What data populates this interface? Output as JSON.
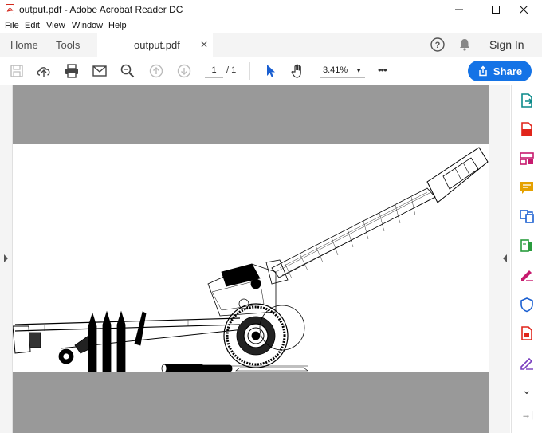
{
  "window": {
    "title": "output.pdf - Adobe Acrobat Reader DC",
    "controls": [
      "minimize",
      "maximize",
      "close"
    ]
  },
  "menu": [
    "File",
    "Edit",
    "View",
    "Window",
    "Help"
  ],
  "tabs": {
    "home": "Home",
    "tools": "Tools",
    "document": "output.pdf",
    "close_symbol": "✕"
  },
  "account": {
    "sign_in": "Sign In"
  },
  "toolbar": {
    "page_current": "1",
    "page_total": "/ 1",
    "zoom": "3.41%",
    "more": "•••",
    "share_label": "Share",
    "icons": [
      "save-icon",
      "upload-icon",
      "print-icon",
      "email-icon",
      "zoom-search-icon",
      "page-up-icon",
      "page-down-icon",
      "select-cursor-icon",
      "hand-tool-icon",
      "more-icon"
    ]
  },
  "right_panel": {
    "tools": [
      "export-pdf-icon",
      "create-pdf-icon",
      "organize-pages-icon",
      "comment-icon",
      "combine-files-icon",
      "edit-pdf-icon",
      "fill-sign-icon",
      "protect-icon",
      "convert-pdf-icon",
      "request-signature-icon"
    ],
    "expand_symbol": "⌄",
    "collapse_symbol": "→|"
  },
  "colors": {
    "accent": "#1473e6",
    "doc_background": "#999999",
    "tool_red": "#e1251b",
    "tool_teal": "#0b8a8a",
    "tool_pink": "#c71a6e",
    "tool_yellow": "#e5a100",
    "tool_purple": "#7a3fbf",
    "tool_green": "#2a9c3e",
    "tool_blue": "#1a5fd1"
  }
}
